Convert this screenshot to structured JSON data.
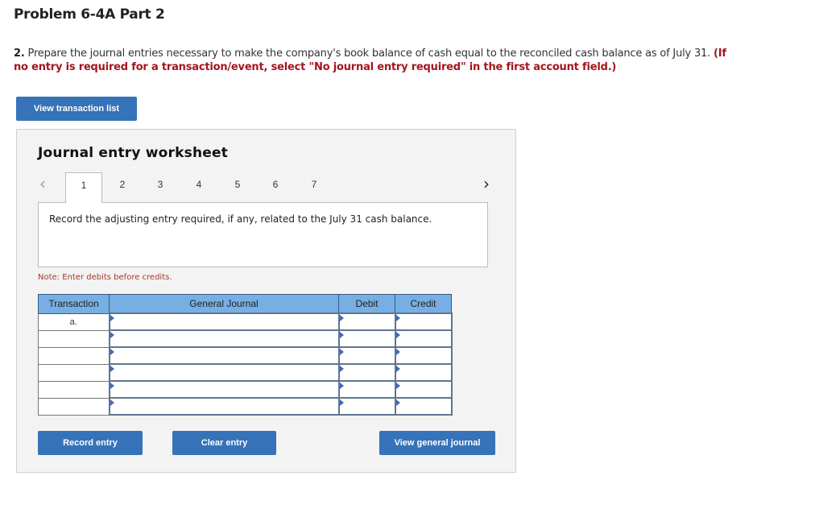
{
  "page": {
    "title": "Problem 6-4A Part 2",
    "instructions": {
      "number": "2.",
      "text": "Prepare the journal entries necessary to make the company's book balance of cash equal to the reconciled cash balance as of July 31.",
      "note": "(If no entry is required for a transaction/event, select \"No journal entry required\" in the first account field.)"
    },
    "view_transaction_list_label": "View transaction list"
  },
  "worksheet": {
    "title": "Journal entry worksheet",
    "prev_icon": "chevron-left",
    "next_icon": "chevron-right",
    "tabs": [
      "1",
      "2",
      "3",
      "4",
      "5",
      "6",
      "7"
    ],
    "active_tab": "1",
    "description": "Record the adjusting entry required, if any, related to the July 31 cash balance.",
    "note": "Note: Enter debits before credits.",
    "table": {
      "headers": [
        "Transaction",
        "General Journal",
        "Debit",
        "Credit"
      ],
      "rows": [
        {
          "transaction": "a.",
          "account": "",
          "debit": "",
          "credit": ""
        },
        {
          "transaction": "",
          "account": "",
          "debit": "",
          "credit": ""
        },
        {
          "transaction": "",
          "account": "",
          "debit": "",
          "credit": ""
        },
        {
          "transaction": "",
          "account": "",
          "debit": "",
          "credit": ""
        },
        {
          "transaction": "",
          "account": "",
          "debit": "",
          "credit": ""
        },
        {
          "transaction": "",
          "account": "",
          "debit": "",
          "credit": ""
        }
      ]
    },
    "buttons": {
      "record": "Record entry",
      "clear": "Clear entry",
      "view_journal": "View general journal"
    }
  },
  "colors": {
    "button_bg": "#3673b8",
    "header_bg": "#77aee3",
    "instruction_red": "#a3161d",
    "note_red": "#a33a2a"
  }
}
